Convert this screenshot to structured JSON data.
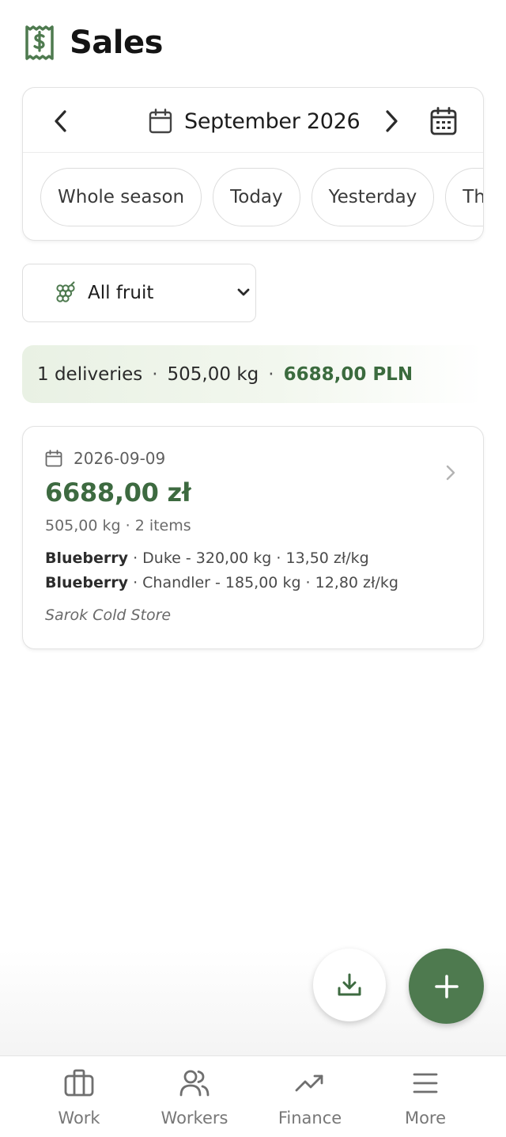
{
  "header": {
    "title": "Sales",
    "icon": "receipt-dollar-icon"
  },
  "period": {
    "month_label": "September 2026",
    "chips": [
      "Whole season",
      "Today",
      "Yesterday",
      "This week"
    ]
  },
  "filter": {
    "fruit_label": "All fruit"
  },
  "summary": {
    "deliveries": "1 deliveries",
    "weight": "505,00 kg",
    "total": "6688,00 PLN",
    "separator": "·"
  },
  "sales": [
    {
      "date": "2026-09-09",
      "amount": "6688,00 zł",
      "meta": "505,00 kg · 2 items",
      "items": [
        {
          "fruit": "Blueberry",
          "detail": " · Duke - 320,00 kg · 13,50 zł/kg"
        },
        {
          "fruit": "Blueberry",
          "detail": " · Chandler - 185,00 kg · 12,80 zł/kg"
        }
      ],
      "buyer": "Sarok Cold Store"
    }
  ],
  "tabs": [
    {
      "label": "Work",
      "icon": "briefcase-icon"
    },
    {
      "label": "Workers",
      "icon": "users-icon"
    },
    {
      "label": "Finance",
      "icon": "trending-up-icon"
    },
    {
      "label": "More",
      "icon": "menu-icon"
    }
  ],
  "colors": {
    "accent": "#4e7a4f",
    "accent_text": "#3d6a40",
    "summary_bg": "#e9f1e4"
  }
}
